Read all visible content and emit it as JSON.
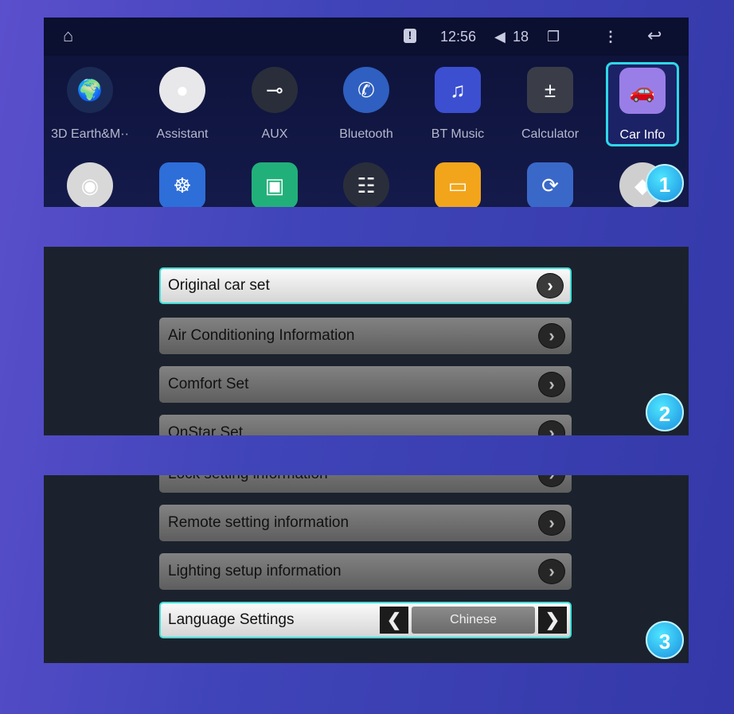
{
  "status_bar": {
    "time": "12:56",
    "volume": "18"
  },
  "apps_row1": [
    {
      "label": "3D Earth&M··",
      "icon": "earth-icon",
      "color": "#1a2a55"
    },
    {
      "label": "Assistant",
      "icon": "assistant-icon",
      "color": "#e8e8ea"
    },
    {
      "label": "AUX",
      "icon": "aux-cable-icon",
      "color": "#2a2e3a"
    },
    {
      "label": "Bluetooth",
      "icon": "bluetooth-phone-icon",
      "color": "#2f5fc0"
    },
    {
      "label": "BT Music",
      "icon": "bt-music-icon",
      "color": "#3b4fd0"
    },
    {
      "label": "Calculator",
      "icon": "calculator-icon",
      "color": "#3a3d48"
    },
    {
      "label": "Car Info",
      "icon": "car-info-icon",
      "color": "#9a7ee8"
    }
  ],
  "apps_row2": [
    {
      "icon": "chrome-icon",
      "color": "#d8d8d8"
    },
    {
      "icon": "steering-wheel-icon",
      "color": "#2e6ed8"
    },
    {
      "icon": "camera-app-icon",
      "color": "#22b07a"
    },
    {
      "icon": "equalizer-icon",
      "color": "#2a2e3a"
    },
    {
      "icon": "folder-icon",
      "color": "#f2a51a"
    },
    {
      "icon": "cloud-sync-icon",
      "color": "#3a68c8"
    },
    {
      "icon": "photos-icon",
      "color": "#cfcfcf"
    }
  ],
  "menu1": [
    "Original car set",
    "Air Conditioning Information",
    "Comfort Set",
    "OnStar Set"
  ],
  "menu2": [
    "Lock setting information",
    "Remote setting information",
    "Lighting setup information"
  ],
  "language": {
    "label": "Language Settings",
    "value": "Chinese"
  },
  "badges": [
    "1",
    "2",
    "3"
  ]
}
